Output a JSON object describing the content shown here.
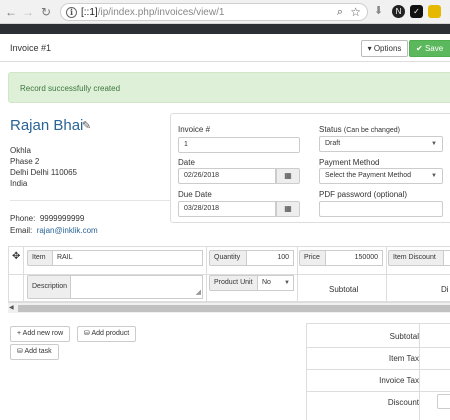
{
  "browser": {
    "url_prefix": "[::1]",
    "url_path": "/ip/index.php/invoices/view/1"
  },
  "header": {
    "title": "Invoice #1",
    "options_label": "Options",
    "save_label": "Save"
  },
  "alert": {
    "message": "Record successfully created"
  },
  "client": {
    "name": "Rajan Bhai",
    "address": [
      "Okhla",
      "Phase 2",
      "Delhi Delhi 110065",
      "India"
    ],
    "phone_label": "Phone:",
    "phone": "9999999999",
    "email_label": "Email:",
    "email": "rajan@inklik.com"
  },
  "invoice": {
    "number_label": "Invoice #",
    "number": "1",
    "date_label": "Date",
    "date": "02/26/2018",
    "due_label": "Due Date",
    "due": "03/28/2018",
    "status_label": "Status",
    "status_hint": "(Can be changed)",
    "status": "Draft",
    "payment_label": "Payment Method",
    "payment_placeholder": "Select the Payment Method",
    "pdf_label": "PDF password (optional)",
    "pdf_value": ""
  },
  "item": {
    "item_label": "Item",
    "item_value": "RAIL",
    "qty_label": "Quantity",
    "qty_value": "100",
    "price_label": "Price",
    "price_value": "150000",
    "discount_label": "Item Discount",
    "description_label": "Description",
    "product_unit_label": "Product Unit",
    "product_unit_value": "No",
    "subtotal_label": "Subtotal",
    "discount_cut_label": "Di"
  },
  "actions": {
    "add_row": "Add new row",
    "add_product": "Add product",
    "add_task": "Add task"
  },
  "totals": [
    "Subtotal",
    "Item Tax",
    "Invoice Tax",
    "Discount"
  ]
}
